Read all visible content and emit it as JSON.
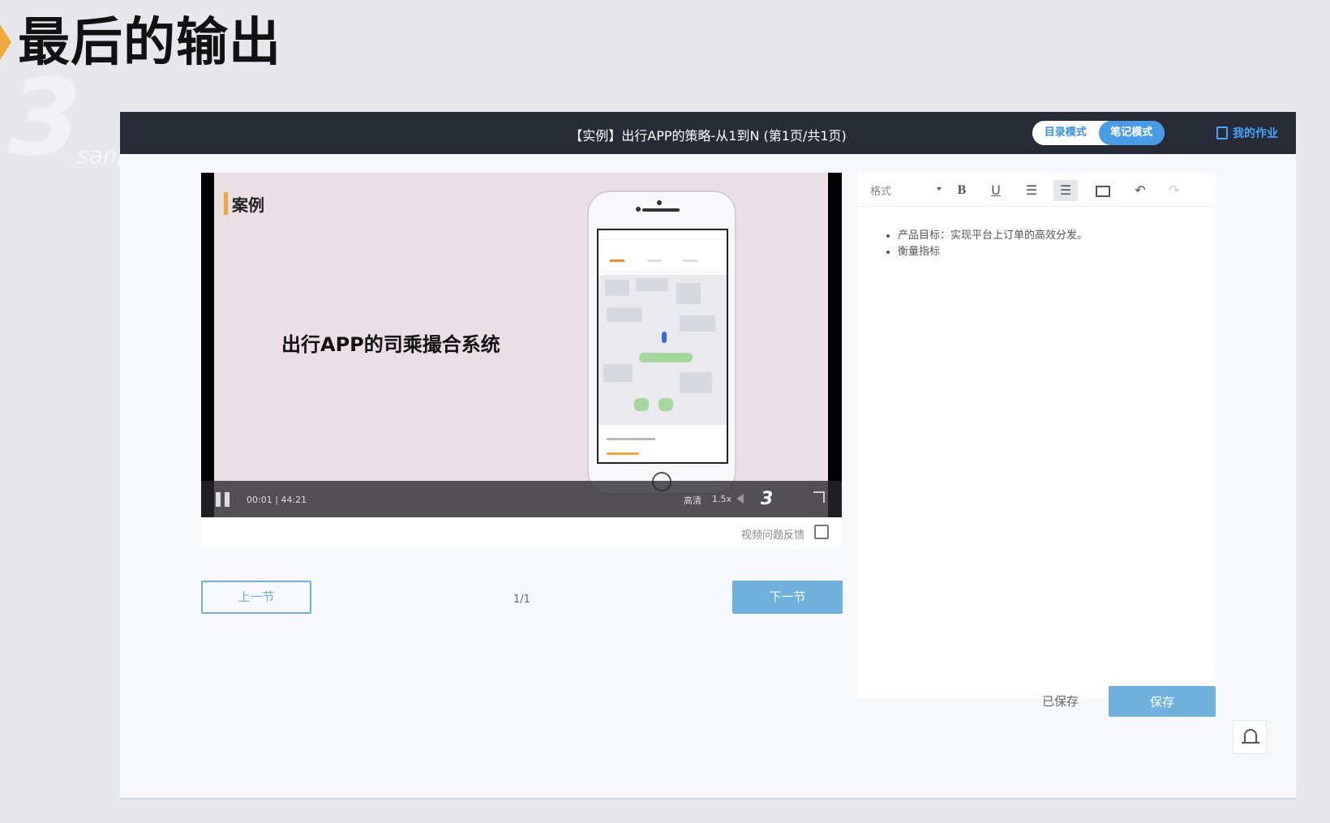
{
  "slide": {
    "title": "最后的输出",
    "watermark_text": "sanjieke.cn"
  },
  "app": {
    "window_title": "【实例】出行APP的策略-从1到N (第1页/共1页)",
    "mode_catalog": "目录模式",
    "mode_notes": "笔记模式",
    "homework": "我的作业"
  },
  "video": {
    "case_label": "案例",
    "headline": "出行APP的司乘撮合系统",
    "current_time": "00:01",
    "duration": "44:21",
    "quality": "高清",
    "speed": "1.5x",
    "feedback": "视频问题反馈"
  },
  "pager": {
    "prev": "上一节",
    "page": "1/1",
    "next": "下一节"
  },
  "editor": {
    "format_label": "格式",
    "notes": [
      "产品目标：实现平台上订单的高效分发。",
      "衡量指标"
    ],
    "saved_status": "已保存",
    "save_label": "保存"
  },
  "colors": {
    "accent": "#6fb0dc",
    "topbar": "#262b36",
    "marker": "#f2a93b"
  }
}
